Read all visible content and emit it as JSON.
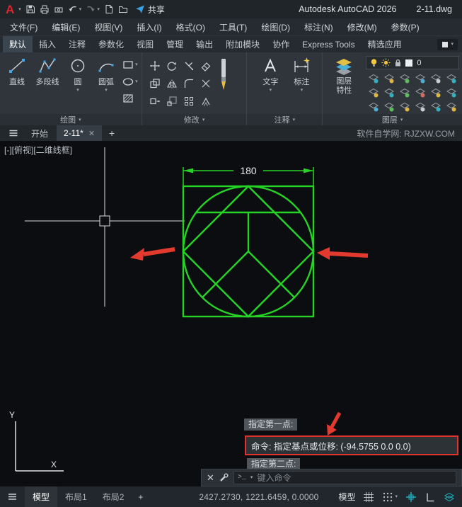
{
  "title_bar": {
    "app_title": "Autodesk AutoCAD 2026",
    "doc_title": "2-11.dwg",
    "share_label": "共享"
  },
  "menu_bar": {
    "items": [
      "文件(F)",
      "编辑(E)",
      "视图(V)",
      "插入(I)",
      "格式(O)",
      "工具(T)",
      "绘图(D)",
      "标注(N)",
      "修改(M)",
      "参数(P)"
    ]
  },
  "ribbon_tabs": [
    "默认",
    "插入",
    "注释",
    "参数化",
    "视图",
    "管理",
    "输出",
    "附加模块",
    "协作",
    "Express Tools",
    "精选应用"
  ],
  "ribbon": {
    "draw_panel": {
      "label": "绘图",
      "tools": [
        {
          "label": "直线"
        },
        {
          "label": "多段线"
        },
        {
          "label": "圆"
        },
        {
          "label": "圆弧"
        }
      ]
    },
    "modify_panel": {
      "label": "修改"
    },
    "annotate_panel": {
      "label": "注释",
      "text_tool": "文字",
      "dim_tool": "标注"
    },
    "layer_props": {
      "line1": "图层",
      "line2": "特性"
    },
    "layer_panel": {
      "label": "图层",
      "current_layer": "0"
    }
  },
  "file_tab_bar": {
    "tabs": [
      {
        "label": "开始"
      },
      {
        "label": "2-11*",
        "active": true
      }
    ],
    "site_text": "软件自学网: RJZXW.COM"
  },
  "drawing": {
    "viewport_label": "[-][俯视][二维线框]",
    "dimension_text": "180",
    "prompt_first": "指定第一点:",
    "command_text": "命令: 指定基点或位移:  (-94.5755 0.0 0.0)",
    "prompt_second": "指定第二点:",
    "ucs_x": "X",
    "ucs_y": "Y",
    "colors": {
      "geometry_green": "#26d426",
      "annotation_red": "#e23a2f",
      "highlight_border": "#e2342c",
      "crosshair": "#dadde0"
    }
  },
  "command_line": {
    "placeholder": "键入命令"
  },
  "status_bar": {
    "layout_tabs": [
      {
        "label": "模型",
        "active": true
      },
      {
        "label": "布局1"
      },
      {
        "label": "布局2"
      }
    ],
    "coordinates": "2427.2730, 1221.6459, 0.0000",
    "model_button": "模型",
    "accent_teal": "#1db4c2"
  }
}
